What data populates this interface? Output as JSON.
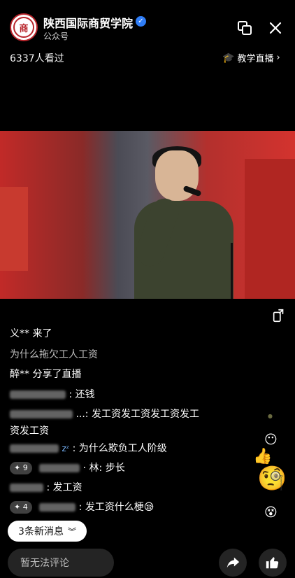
{
  "header": {
    "title": "陕西国际商贸学院",
    "subtitle": "公众号",
    "logo_text": "商"
  },
  "viewers": "6337人看过",
  "teach_link": "教学直播",
  "comments": [
    {
      "text": "义** 来了"
    },
    {
      "text": "为什么拖欠工人工资"
    },
    {
      "text": "醉** 分享了直播"
    },
    {
      "suffix": ": 还钱"
    },
    {
      "suffix": "...: 发工资发工资发工资发工",
      "line2": "资发工资"
    },
    {
      "suffix": ": 为什么欺负工人阶级"
    },
    {
      "badge": "✦ 9",
      "suffix": "· 林: 步长"
    },
    {
      "suffix": ": 发工资"
    },
    {
      "badge": "✦ 4",
      "suffix": ": 发工资什么梗😪"
    }
  ],
  "new_messages": "3条新消息",
  "comment_placeholder": "暂无法评论"
}
